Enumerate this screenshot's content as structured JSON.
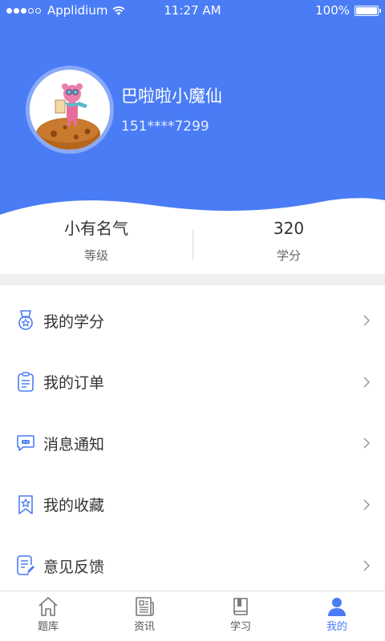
{
  "status_bar": {
    "carrier": "Applidium",
    "time": "11:27 AM",
    "battery": "100%"
  },
  "profile": {
    "username": "巴啦啦小魔仙",
    "phone": "151****7299"
  },
  "stats": {
    "level_value": "小有名气",
    "level_label": "等级",
    "points_value": "320",
    "points_label": "学分"
  },
  "menu": {
    "items": [
      {
        "label": "我的学分",
        "icon": "medal-icon"
      },
      {
        "label": "我的订单",
        "icon": "clipboard-icon"
      },
      {
        "label": "消息通知",
        "icon": "message-icon"
      },
      {
        "label": "我的收藏",
        "icon": "bookmark-star-icon"
      },
      {
        "label": "意见反馈",
        "icon": "feedback-edit-icon"
      }
    ]
  },
  "tabbar": {
    "tabs": [
      {
        "label": "题库",
        "icon": "home-icon"
      },
      {
        "label": "资讯",
        "icon": "newspaper-icon"
      },
      {
        "label": "学习",
        "icon": "book-icon"
      },
      {
        "label": "我的",
        "icon": "user-icon"
      }
    ],
    "active_index": 3
  },
  "colors": {
    "primary": "#4a7cf5",
    "text": "#333333",
    "muted": "#666666",
    "divider": "#efefef"
  }
}
